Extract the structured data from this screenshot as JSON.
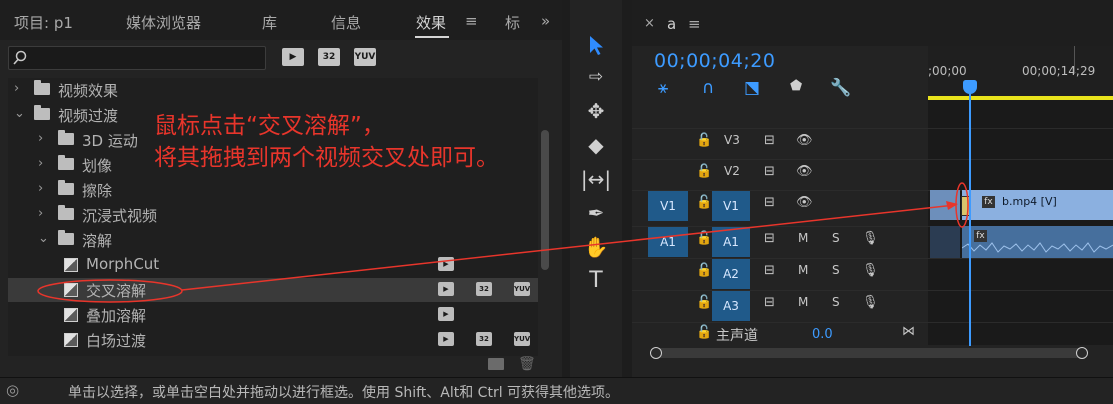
{
  "left_panel": {
    "tabs": [
      "项目: p1",
      "媒体浏览器",
      "库",
      "信息",
      "效果",
      "≡",
      "标",
      "»"
    ],
    "search": {
      "placeholder": "",
      "value": ""
    },
    "filter_badges": [
      "32",
      "YUV"
    ],
    "tree": [
      {
        "label": "视频效果",
        "type": "folder",
        "expanded": false,
        "level": 0
      },
      {
        "label": "视频过渡",
        "type": "folder",
        "expanded": true,
        "level": 0
      },
      {
        "label": "3D 运动",
        "type": "folder",
        "expanded": false,
        "level": 1
      },
      {
        "label": "划像",
        "type": "folder",
        "expanded": false,
        "level": 1
      },
      {
        "label": "擦除",
        "type": "folder",
        "expanded": false,
        "level": 1
      },
      {
        "label": "沉浸式视频",
        "type": "folder",
        "expanded": false,
        "level": 1
      },
      {
        "label": "溶解",
        "type": "folder",
        "expanded": true,
        "level": 1
      },
      {
        "label": "MorphCut",
        "type": "effect",
        "level": 2,
        "badges": [
          "accel"
        ]
      },
      {
        "label": "交叉溶解",
        "type": "effect",
        "level": 2,
        "selected": true,
        "badges": [
          "accel",
          "32",
          "YUV"
        ]
      },
      {
        "label": "叠加溶解",
        "type": "effect",
        "level": 2,
        "badges": [
          "accel"
        ]
      },
      {
        "label": "白场过渡",
        "type": "effect",
        "level": 2,
        "badges": [
          "accel",
          "32",
          "YUV"
        ]
      }
    ]
  },
  "tools": [
    "selection-tool",
    "track-select-tool",
    "ripple-edit-tool",
    "razor-tool",
    "slip-tool",
    "pen-tool",
    "hand-tool",
    "type-tool"
  ],
  "timeline": {
    "tab_close": "×",
    "tab_name": "a",
    "tab_menu": "≡",
    "timecode": "00;00;04;20",
    "ruler_labels": [
      ";00;00",
      "00;00;14;29"
    ],
    "video_tracks": [
      {
        "source": "",
        "name": "V3"
      },
      {
        "source": "",
        "name": "V2"
      },
      {
        "source": "V1",
        "name": "V1"
      }
    ],
    "audio_tracks": [
      {
        "source": "A1",
        "name": "A1",
        "m": "M",
        "s": "S"
      },
      {
        "source": "",
        "name": "A2",
        "m": "M",
        "s": "S"
      },
      {
        "source": "",
        "name": "A3",
        "m": "M",
        "s": "S"
      }
    ],
    "master": {
      "label": "主声道",
      "value": "0.0"
    },
    "clip_video_label": "b.mp4 [V]",
    "fx_label": "fx"
  },
  "annotation": {
    "line1": "鼠标点击“交叉溶解”，",
    "line2": "将其拖拽到两个视频交叉处即可。",
    "color": "#e8352b"
  },
  "statusbar": {
    "text": "单击以选择，或单击空白处并拖动以进行框选。使用 Shift、Alt和 Ctrl 可获得其他选项。"
  }
}
